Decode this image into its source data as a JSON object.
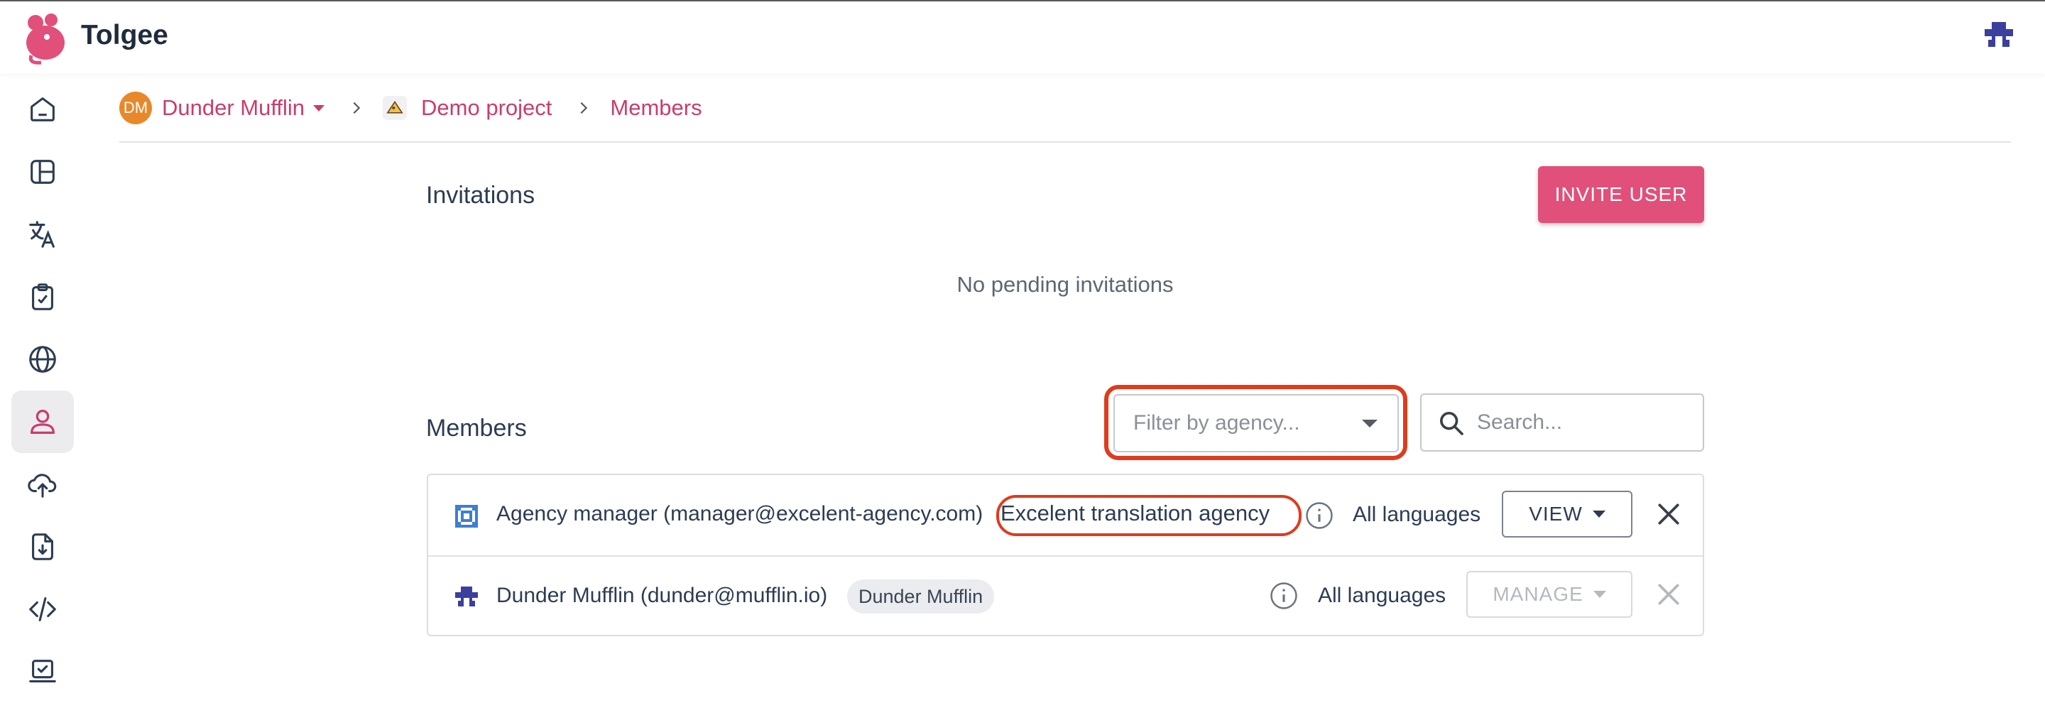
{
  "app": {
    "name": "Tolgee"
  },
  "colors": {
    "accent": "#e0507a",
    "link": "#c93d6c",
    "highlight": "#de3c1d",
    "org_avatar": "#e8882a"
  },
  "sidebar": {
    "items": [
      {
        "icon": "home-icon"
      },
      {
        "icon": "dashboard-icon"
      },
      {
        "icon": "translate-icon"
      },
      {
        "icon": "tasks-clipboard-icon"
      },
      {
        "icon": "globe-icon"
      },
      {
        "icon": "user-icon",
        "active": true
      },
      {
        "icon": "cloud-upload-icon"
      },
      {
        "icon": "file-download-icon"
      },
      {
        "icon": "code-icon"
      },
      {
        "icon": "laptop-check-icon"
      }
    ]
  },
  "breadcrumb": {
    "org_initials": "DM",
    "org_name": "Dunder Mufflin",
    "project": "Demo project",
    "current": "Members"
  },
  "invitations": {
    "title": "Invitations",
    "invite_button": "INVITE USER",
    "empty_text": "No pending invitations"
  },
  "members": {
    "title": "Members",
    "filter_placeholder": "Filter by agency...",
    "search_placeholder": "Search...",
    "rows": [
      {
        "name": "Agency manager (manager@excelent-agency.com)",
        "agency": "Excelent translation agency",
        "languages": "All languages",
        "role": "VIEW",
        "role_enabled": true
      },
      {
        "name": "Dunder Mufflin (dunder@mufflin.io)",
        "org_chip": "Dunder Mufflin",
        "languages": "All languages",
        "role": "MANAGE",
        "role_enabled": false
      }
    ]
  }
}
